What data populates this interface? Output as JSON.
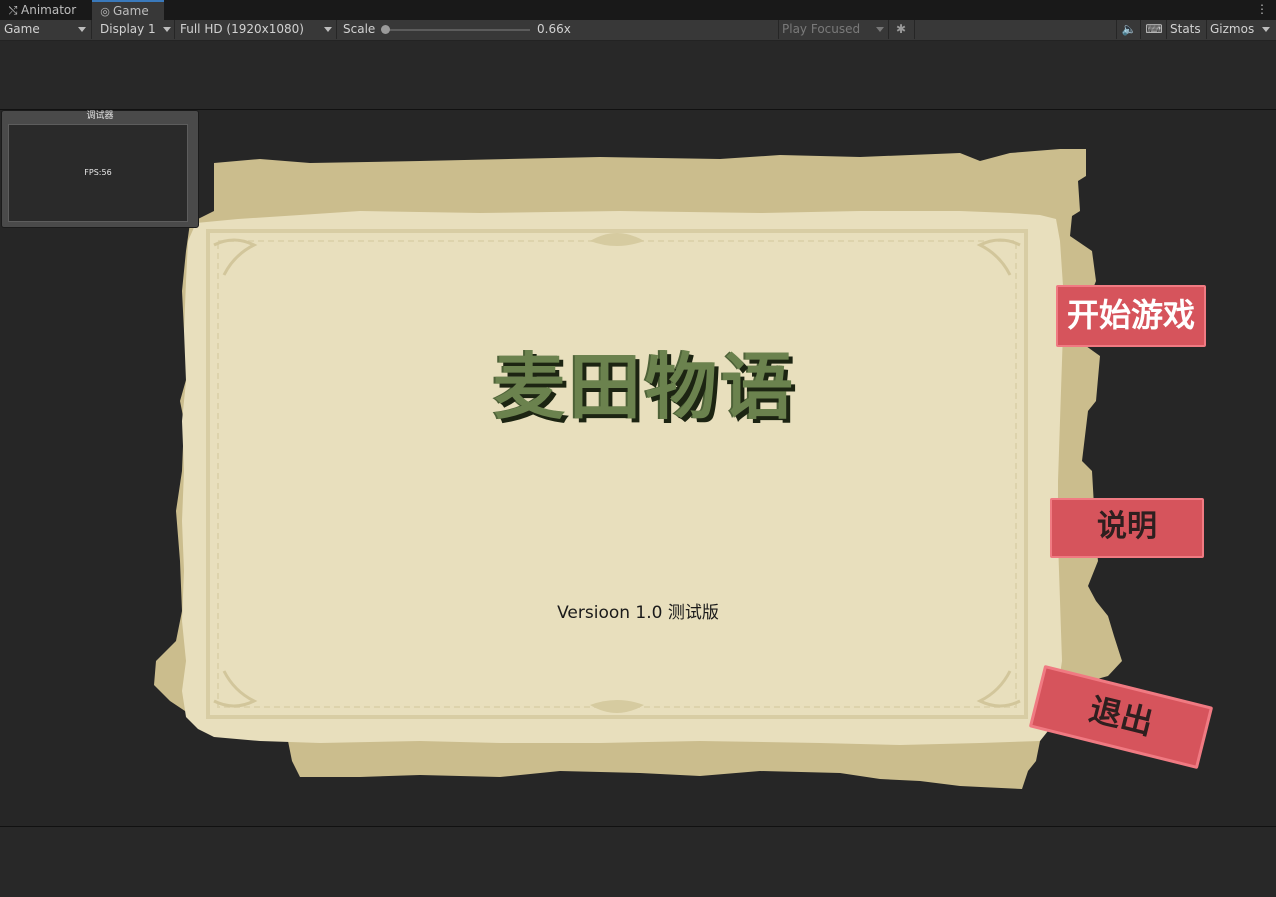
{
  "tabs": [
    {
      "label": "Animator",
      "icon": "animator-icon",
      "active": false
    },
    {
      "label": "Game",
      "icon": "gamepad-icon",
      "active": true
    }
  ],
  "toolbar": {
    "view_select": "Game",
    "display_select": "Display 1",
    "resolution_select": "Full HD (1920x1080)",
    "scale_label": "Scale",
    "scale_value": "0.66x",
    "play_mode_select": "Play Focused",
    "stats_label": "Stats",
    "gizmos_label": "Gizmos"
  },
  "debug_window": {
    "title": "调试器",
    "fps_text": "FPS:56"
  },
  "game": {
    "title": "麦田物语",
    "version": "Versioon 1.0 测试版",
    "buttons": {
      "start": "开始游戏",
      "info": "说明",
      "exit": "退出"
    },
    "colors": {
      "paper": "#e8dfbd",
      "paper_shadow": "#cfc193",
      "button": "#d6545c",
      "title": "#6b824e"
    }
  }
}
